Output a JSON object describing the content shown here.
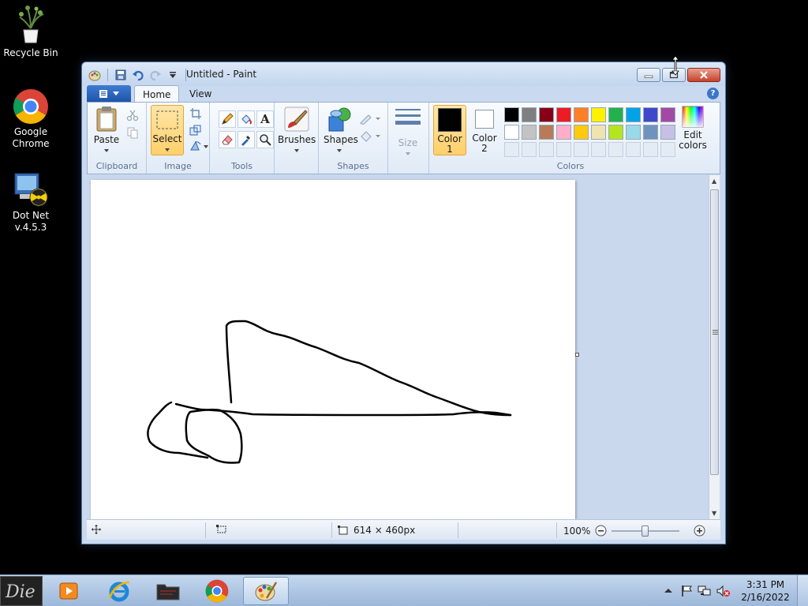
{
  "desktop": {
    "icons": [
      {
        "label": "Recycle Bin"
      },
      {
        "label": "Google Chrome"
      },
      {
        "label": "Dot Net v.4.5.3"
      }
    ]
  },
  "window": {
    "title": "Untitled - Paint",
    "tabs": {
      "home": "Home",
      "view": "View"
    },
    "help": "?"
  },
  "ribbon": {
    "clipboard": {
      "label": "Clipboard",
      "paste": "Paste"
    },
    "image": {
      "label": "Image",
      "select": "Select"
    },
    "tools": {
      "label": "Tools"
    },
    "brushes": "Brushes",
    "shapes": {
      "label": "Shapes",
      "shapes_btn": "Shapes"
    },
    "size": "Size",
    "color1": "Color 1",
    "color2": "Color 2",
    "colors_label": "Colors",
    "edit_colors": "Edit colors",
    "palette_row1": [
      "#000000",
      "#7f7f7f",
      "#880015",
      "#ed1c24",
      "#ff7f27",
      "#fff200",
      "#22b14c",
      "#00a2e8",
      "#3f48cc",
      "#a349a4"
    ],
    "palette_row2": [
      "#ffffff",
      "#c3c3c3",
      "#b97a57",
      "#ffaec9",
      "#ffc90e",
      "#efe4b0",
      "#b5e61d",
      "#99d9ea",
      "#7092be",
      "#c8bfe7"
    ],
    "color1_value": "#000000",
    "color2_value": "#ffffff"
  },
  "status": {
    "image_size": "614 × 460px",
    "zoom": "100%"
  },
  "taskbar": {
    "time": "3:31 PM",
    "date": "2/16/2022"
  }
}
